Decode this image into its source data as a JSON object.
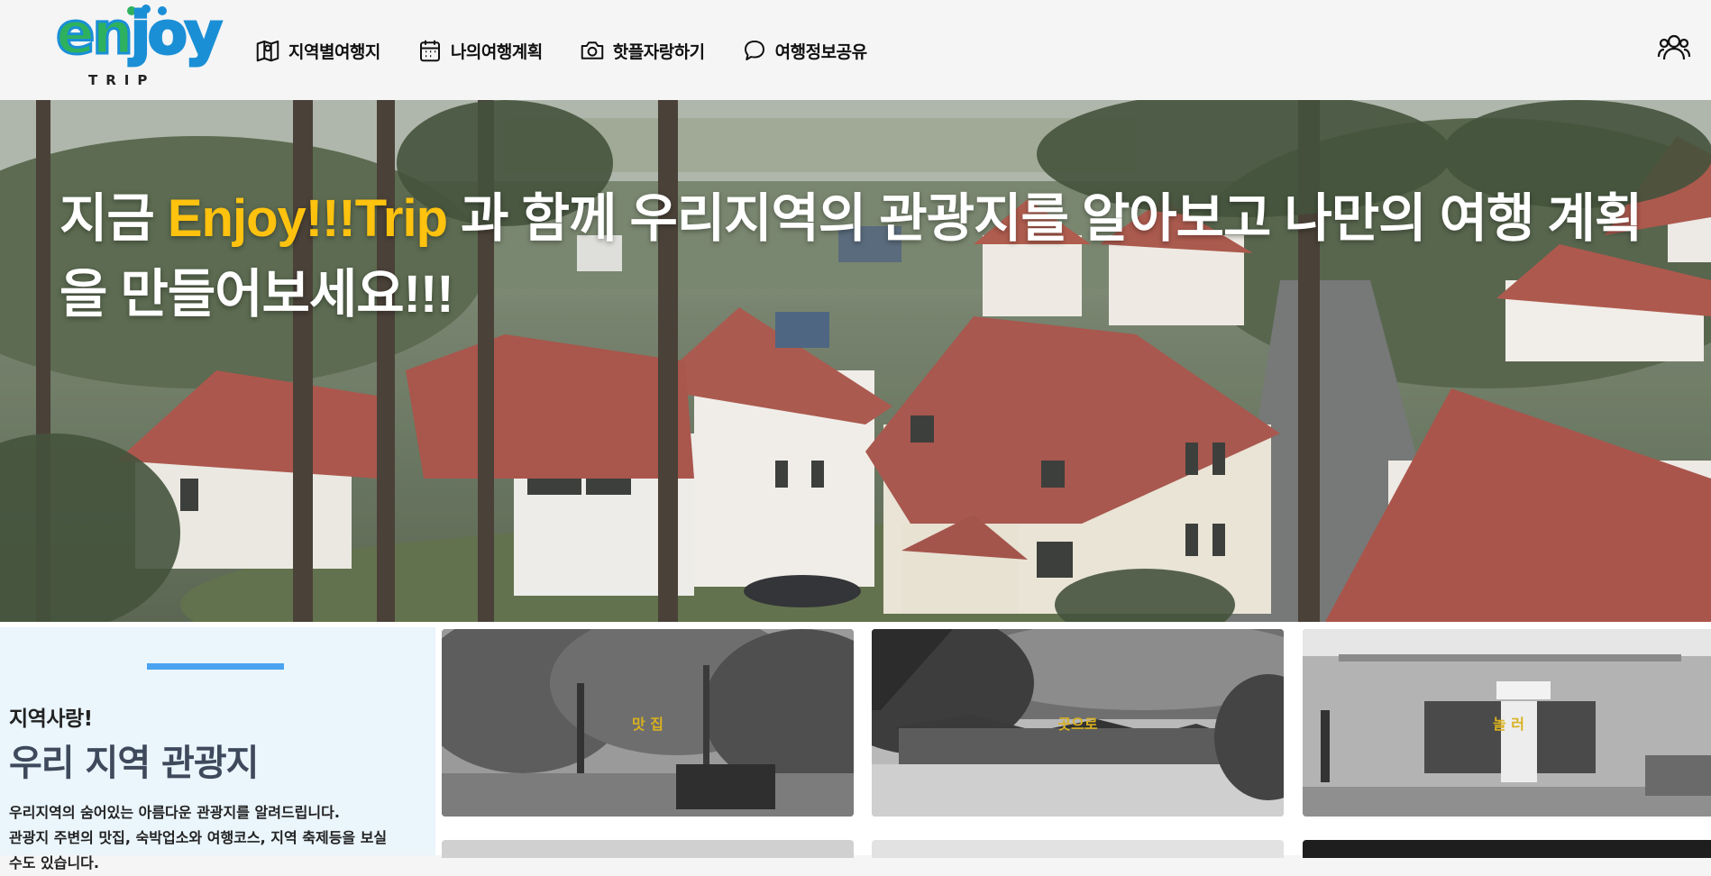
{
  "header": {
    "logo": {
      "word": "enjoy",
      "sub": "TRIP"
    },
    "nav": [
      {
        "label": "지역별여행지",
        "icon": "map-icon"
      },
      {
        "label": "나의여행계획",
        "icon": "calendar-icon"
      },
      {
        "label": "핫플자랑하기",
        "icon": "camera-icon"
      },
      {
        "label": "여행정보공유",
        "icon": "chat-icon"
      }
    ],
    "user_icon": "users-icon"
  },
  "hero": {
    "text_before": "지금 ",
    "accent": "Enjoy!!!Trip",
    "text_after": " 과 함께 우리지역의 관광지를 알아보고 나만의 여행 계획을 만들어보세요!!!",
    "accent_color": "#ffc20e"
  },
  "intro": {
    "subtitle": "지역사랑!",
    "title": "우리 지역 관광지",
    "desc_line1": "우리지역의 숨어있는 아름다운 관광지를 알려드립니다.",
    "desc_line2": "관광지 주변의 맛집, 숙박업소와 여행코스, 지역 축제등을 보실",
    "desc_line3": "수도 있습니다.",
    "accent_color": "#4aa3f0"
  },
  "cards": [
    {
      "label": "맛 집"
    },
    {
      "label": "곳으로"
    },
    {
      "label": "놀 러"
    }
  ]
}
